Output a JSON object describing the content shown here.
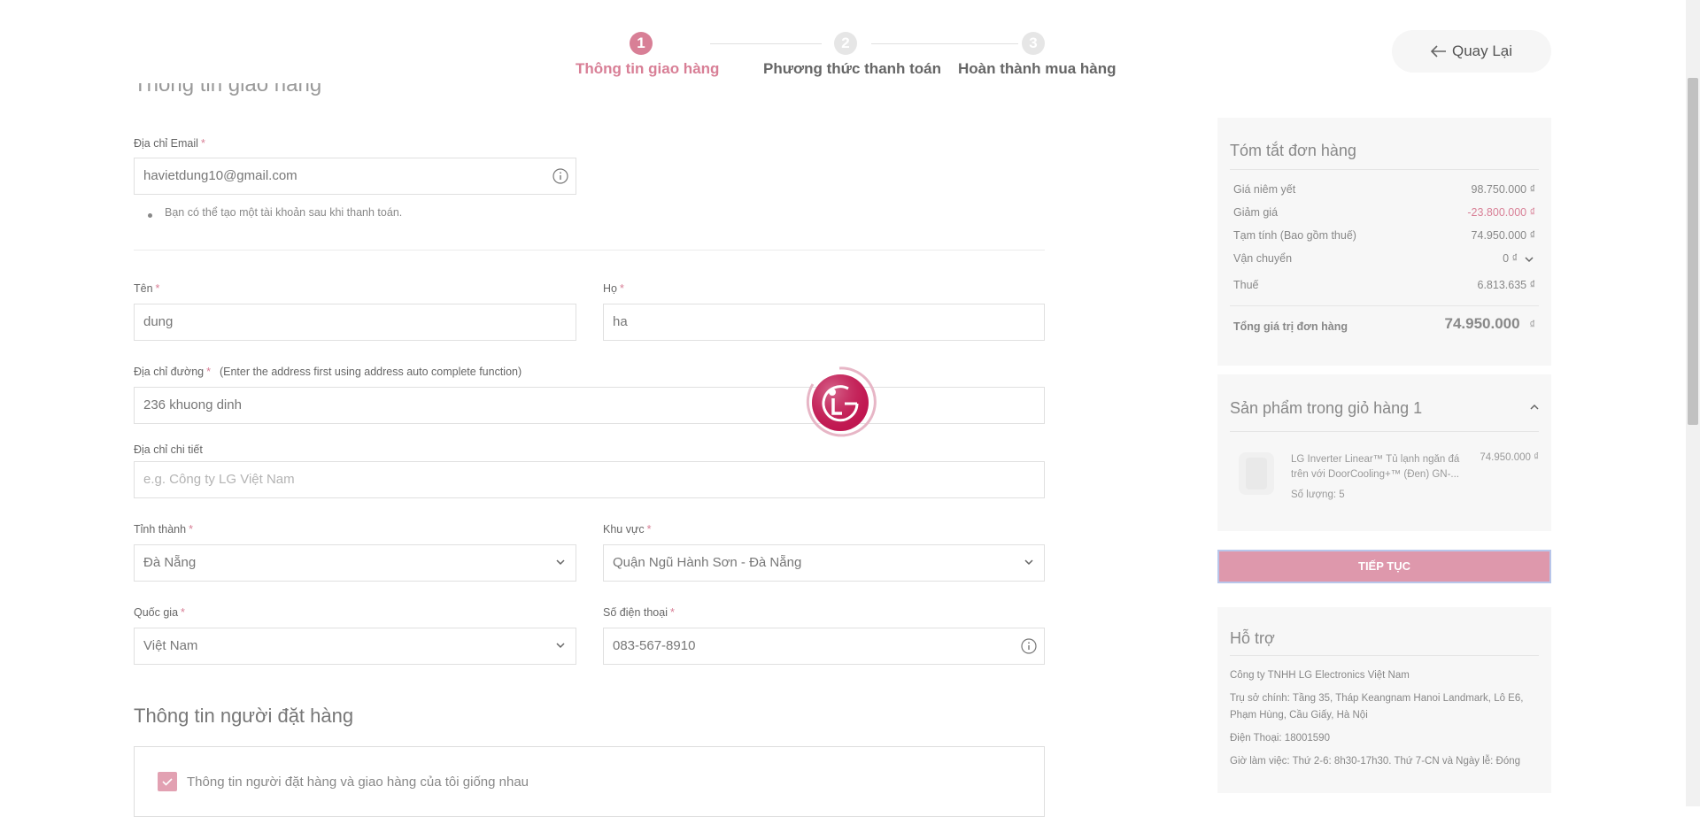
{
  "stepper": {
    "steps": [
      {
        "number": "1",
        "label": "Thông tin giao hàng"
      },
      {
        "number": "2",
        "label": "Phương thức thanh toán"
      },
      {
        "number": "3",
        "label": "Hoàn thành mua hàng"
      }
    ]
  },
  "header": {
    "back_label": "Quay Lại"
  },
  "shipping": {
    "title": "Thông tin giao hàng",
    "email": {
      "label": "Địa chỉ Email",
      "value": "havietdung10@gmail.com",
      "note": "Bạn có thể tạo một tài khoản sau khi thanh toán."
    },
    "first_name": {
      "label": "Tên",
      "value": "dung"
    },
    "last_name": {
      "label": "Họ",
      "value": "ha"
    },
    "street": {
      "label": "Địa chỉ đường",
      "hint": "(Enter the address first using address auto complete function)",
      "value": "236 khuong dinh"
    },
    "detail": {
      "label": "Địa chỉ chi tiết",
      "placeholder": "e.g. Công ty LG Việt Nam"
    },
    "province": {
      "label": "Tỉnh thành",
      "value": "Đà Nẵng"
    },
    "district": {
      "label": "Khu vực",
      "value": "Quận Ngũ Hành Sơn - Đà Nẵng"
    },
    "country": {
      "label": "Quốc gia",
      "value": "Việt Nam"
    },
    "phone": {
      "label": "Số điện thoại",
      "value": "083-567-8910"
    },
    "required_mark": "*"
  },
  "orderer": {
    "title": "Thông tin người đặt hàng",
    "same_as_shipping_label": "Thông tin người đặt hàng và giao hàng của tôi giống nhau",
    "same_as_shipping_checked": true
  },
  "summary": {
    "title": "Tóm tắt đơn hàng",
    "rows": [
      {
        "label": "Giá niêm yết",
        "value": "98.750.000 ₫"
      },
      {
        "label": "Giảm giá",
        "value": "-23.800.000 ₫"
      },
      {
        "label": "Tạm tính (Bao gồm thuế)",
        "value": "74.950.000 ₫"
      },
      {
        "label": "Vận chuyển",
        "value": "0 ₫"
      },
      {
        "label": "Thuế",
        "value": "6.813.635 ₫"
      }
    ],
    "total_label": "Tổng giá trị đơn hàng",
    "total_value": "74.950.000",
    "total_currency": "₫",
    "discount_color": "#d87f96"
  },
  "cart": {
    "title": "Sản phẩm trong giỏ hàng 1",
    "items": [
      {
        "name": "LG Inverter Linear™ Tủ lạnh ngăn đá trên với DoorCooling+™ (Đen) GN-...",
        "price": "74.950.000 ₫",
        "quantity": "Số lượng: 5"
      }
    ]
  },
  "continue_label": "TIẾP TỤC",
  "support": {
    "title": "Hỗ trợ",
    "lines": [
      "Công ty TNHH LG Electronics Việt Nam",
      "Trụ sở chính: Tầng 35, Tháp Keangnam Hanoi Landmark, Lô E6, Phạm Hùng, Cầu Giấy, Hà Nội",
      "Điện Thoại: 18001590",
      "Giờ làm việc: Thứ 2-6: 8h30-17h30. Thứ 7-CN và Ngày lễ: Đóng"
    ]
  },
  "colors": {
    "accent": "#d87f96",
    "brand_logo": "#c0154f"
  },
  "icons": {
    "back": "arrow-left-icon",
    "info": "info-circle-icon",
    "select": "chevron-down-icon",
    "collapse": "chevron-up-icon",
    "check": "check-icon",
    "loader": "lg-logo-loader-icon"
  }
}
